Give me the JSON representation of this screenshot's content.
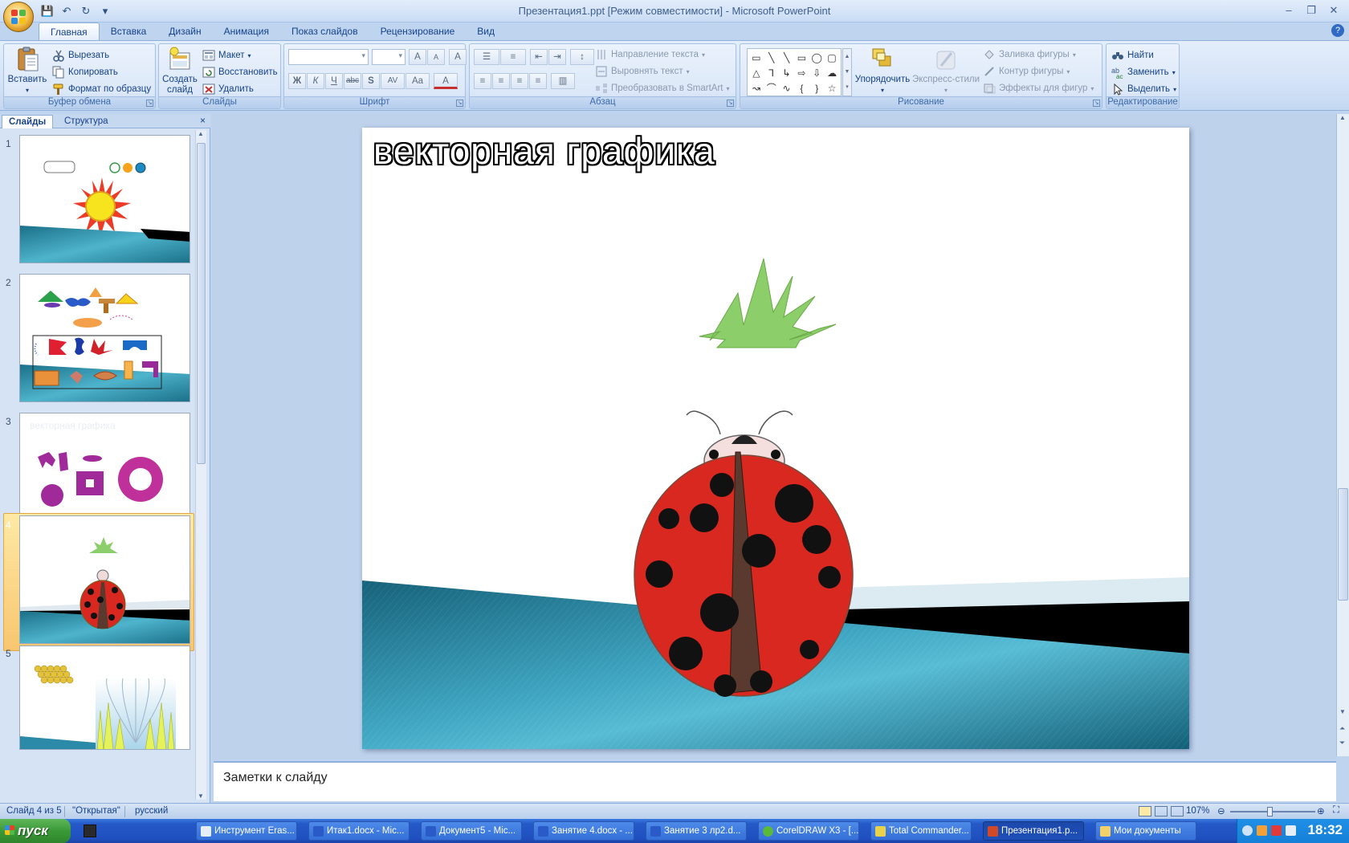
{
  "window": {
    "title": "Презентация1.ppt [Режим совместимости] - Microsoft PowerPoint",
    "minimize": "–",
    "restore": "❐",
    "close": "✕"
  },
  "qat": {
    "save": "💾",
    "undo": "↶",
    "redo": "↻",
    "more": "▾"
  },
  "tabs": [
    "Главная",
    "Вставка",
    "Дизайн",
    "Анимация",
    "Показ слайдов",
    "Рецензирование",
    "Вид"
  ],
  "active_tab": "Главная",
  "help": "?",
  "ribbon": {
    "clipboard": {
      "label": "Буфер обмена",
      "paste": "Вставить",
      "cut": "Вырезать",
      "copy": "Копировать",
      "format_painter": "Формат по образцу"
    },
    "slides": {
      "label": "Слайды",
      "new_slide_line1": "Создать",
      "new_slide_line2": "слайд",
      "layout": "Макет",
      "reset": "Восстановить",
      "delete": "Удалить"
    },
    "font": {
      "label": "Шрифт",
      "font_name": "",
      "font_size": "",
      "bold": "Ж",
      "italic": "К",
      "underline": "Ч",
      "strike": "abc",
      "shadow": "S",
      "spacing": "AV",
      "case": "Aa",
      "color": "A",
      "grow": "A",
      "shrink": "A",
      "clear": "A"
    },
    "paragraph": {
      "label": "Абзац",
      "text_direction": "Направление текста",
      "align_text": "Выровнять текст",
      "convert_smartart": "Преобразовать в SmartArt"
    },
    "drawing": {
      "label": "Рисование",
      "arrange": "Упорядочить",
      "quick_styles": "Экспресс-стили",
      "shape_fill": "Заливка фигуры",
      "shape_outline": "Контур фигуры",
      "shape_effects": "Эффекты для фигур",
      "shapes": [
        "▭",
        "╲",
        "╲",
        "▭",
        "◯",
        "▢",
        "△",
        "⅂",
        "↳",
        "⇨",
        "⇩",
        "☁",
        "↝",
        "⌒",
        "∿",
        "{",
        "}",
        "☆"
      ]
    },
    "editing": {
      "label": "Редактирование",
      "find": "Найти",
      "replace": "Заменить",
      "select": "Выделить"
    }
  },
  "pane": {
    "tab_slides": "Слайды",
    "tab_outline": "Структура",
    "close": "×",
    "slide_numbers": [
      "1",
      "2",
      "3",
      "4",
      "5"
    ],
    "slide3_title": "векторная графика",
    "selected_slide": 4
  },
  "slide": {
    "title": "векторная графика"
  },
  "notes_placeholder": "Заметки к слайду",
  "status": {
    "slide_info": "Слайд 4 из 5",
    "theme": "\"Открытая\"",
    "language": "русский",
    "zoom": "107%"
  },
  "taskbar": {
    "start": "пуск",
    "tasks": [
      "Инструмент Eras...",
      "Итак1.docx - Mic...",
      "Документ5 - Mic...",
      "Занятие 4.docx - ...",
      "Занятие 3 лр2.d...",
      "CorelDRAW X3 - [...",
      "Total Commander...",
      "Презентация1.p...",
      "Мои документы"
    ],
    "active_task": "Презентация1.p...",
    "clock": "18:32"
  },
  "colors": {
    "ribbon_text": "#15428b",
    "ladybug_red": "#d9281f",
    "grass_green": "#8ccf6a",
    "ground_teal": "#2a8aa8",
    "selection": "#f8c66f"
  }
}
